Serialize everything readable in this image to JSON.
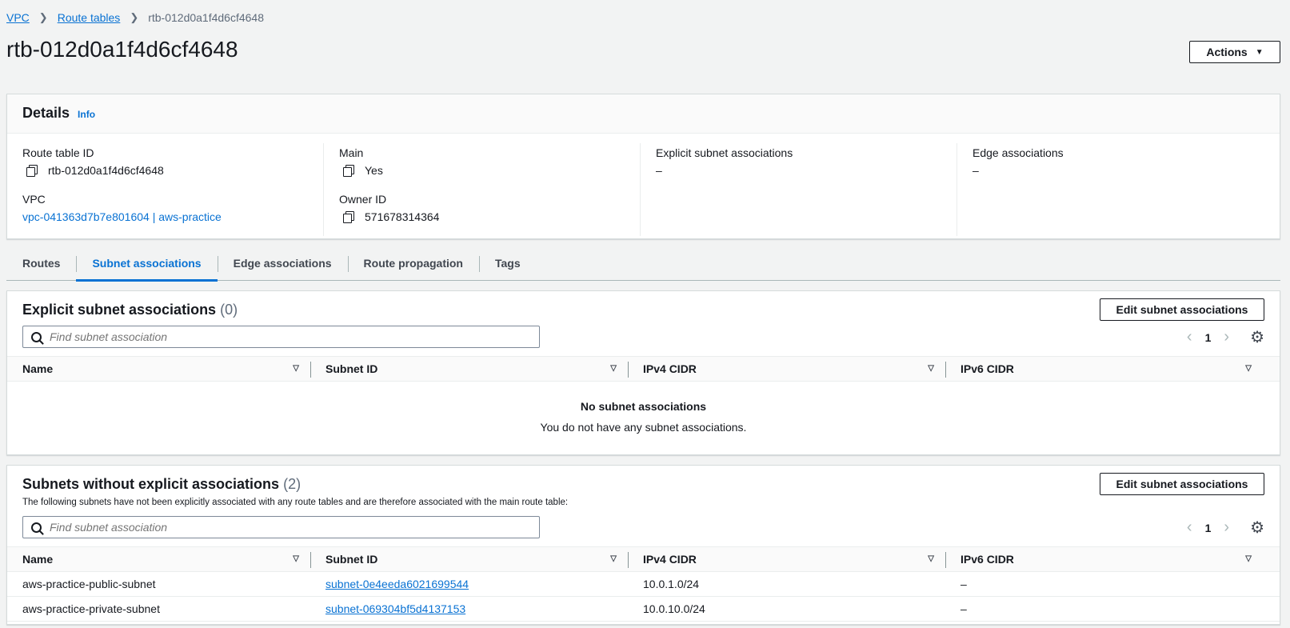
{
  "breadcrumb": {
    "item1": "VPC",
    "item2": "Route tables",
    "current": "rtb-012d0a1f4d6cf4648"
  },
  "page_title": "rtb-012d0a1f4d6cf4648",
  "actions_label": "Actions",
  "details": {
    "title": "Details",
    "info": "Info",
    "route_table_id_label": "Route table ID",
    "route_table_id": "rtb-012d0a1f4d6cf4648",
    "vpc_label": "VPC",
    "vpc_value": "vpc-041363d7b7e801604 | aws-practice",
    "main_label": "Main",
    "main_value": "Yes",
    "owner_label": "Owner ID",
    "owner_value": "571678314364",
    "explicit_label": "Explicit subnet associations",
    "explicit_value": "–",
    "edge_label": "Edge associations",
    "edge_value": "–"
  },
  "tabs": [
    "Routes",
    "Subnet associations",
    "Edge associations",
    "Route propagation",
    "Tags"
  ],
  "explicit": {
    "title": "Explicit subnet associations",
    "count": "(0)",
    "edit_label": "Edit subnet associations",
    "search_placeholder": "Find subnet association",
    "page": "1",
    "empty_title": "No subnet associations",
    "empty_text": "You do not have any subnet associations."
  },
  "columns": [
    "Name",
    "Subnet ID",
    "IPv4 CIDR",
    "IPv6 CIDR"
  ],
  "without": {
    "title": "Subnets without explicit associations",
    "count": "(2)",
    "description": "The following subnets have not been explicitly associated with any route tables and are therefore associated with the main route table:",
    "edit_label": "Edit subnet associations",
    "search_placeholder": "Find subnet association",
    "page": "1",
    "rows": [
      {
        "name": "aws-practice-public-subnet",
        "subnet_id": "subnet-0e4eeda6021699544",
        "ipv4": "10.0.1.0/24",
        "ipv6": "–"
      },
      {
        "name": "aws-practice-private-subnet",
        "subnet_id": "subnet-069304bf5d4137153",
        "ipv4": "10.0.10.0/24",
        "ipv6": "–"
      }
    ]
  },
  "colors": {
    "link": "#0972d3",
    "background": "#f2f3f3"
  },
  "icons": {
    "copy": "copy-icon",
    "search": "search-icon",
    "settings": "gear-icon",
    "sort": "sort-caret-icon"
  }
}
